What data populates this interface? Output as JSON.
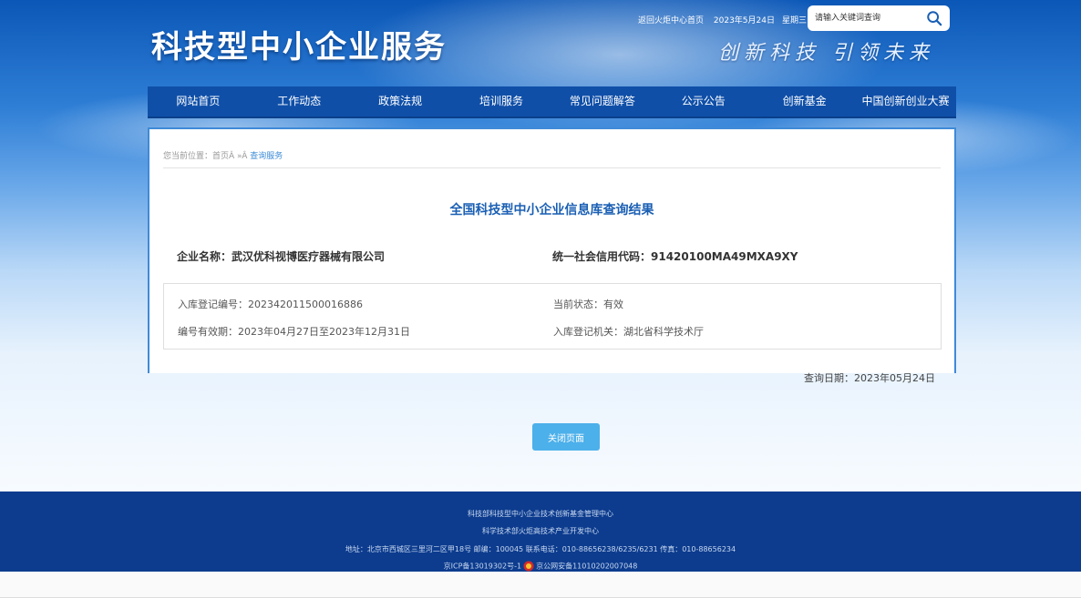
{
  "header": {
    "site_title": "科技型中小企业服务",
    "slogan": "创新科技 引领未来",
    "top_links": {
      "home_link": "返回火炬中心首页",
      "date": "2023年5月24日",
      "weekday": "星期三"
    },
    "search": {
      "placeholder": "请输入关键词查询",
      "icon": "search-icon"
    }
  },
  "nav": {
    "items": [
      {
        "label": "网站首页"
      },
      {
        "label": "工作动态"
      },
      {
        "label": "政策法规"
      },
      {
        "label": "培训服务"
      },
      {
        "label": "常见问题解答"
      },
      {
        "label": "公示公告"
      },
      {
        "label": "创新基金"
      },
      {
        "label": "中国创新创业大赛"
      }
    ]
  },
  "breadcrumb": {
    "prefix": "您当前位置：",
    "home": "首页Â",
    "sep": " »Â ",
    "current": "查询服务"
  },
  "result": {
    "title": "全国科技型中小企业信息库查询结果",
    "company_name": "企业名称：武汉优科视博医疗器械有限公司",
    "credit_code": "统一社会信用代码：91420100MA49MXA9XY",
    "reg_number": "入库登记编号：202342011500016886",
    "status": "当前状态：有效",
    "validity": "编号有效期：2023年04月27日至2023年12月31日",
    "authority": "入库登记机关：湖北省科学技术厅",
    "query_date": "查询日期：2023年05月24日"
  },
  "actions": {
    "close_label": "关闭页面"
  },
  "footer": {
    "line1": "科技部科技型中小企业技术创新基金管理中心",
    "line2": "科学技术部火炬高技术产业开发中心",
    "line3": "地址：北京市西城区三里河二区甲18号 邮编：100045 联系电话：010-88656238/6235/6231 传真：010-88656234",
    "icp": "京ICP备13019302号-1",
    "police_record": "京公网安备11010202007048"
  },
  "colors": {
    "nav_bg": "#0f4fa8",
    "accent": "#1a5fb4",
    "button": "#4cb0ea",
    "footer_bg": "#0d3c8e"
  }
}
